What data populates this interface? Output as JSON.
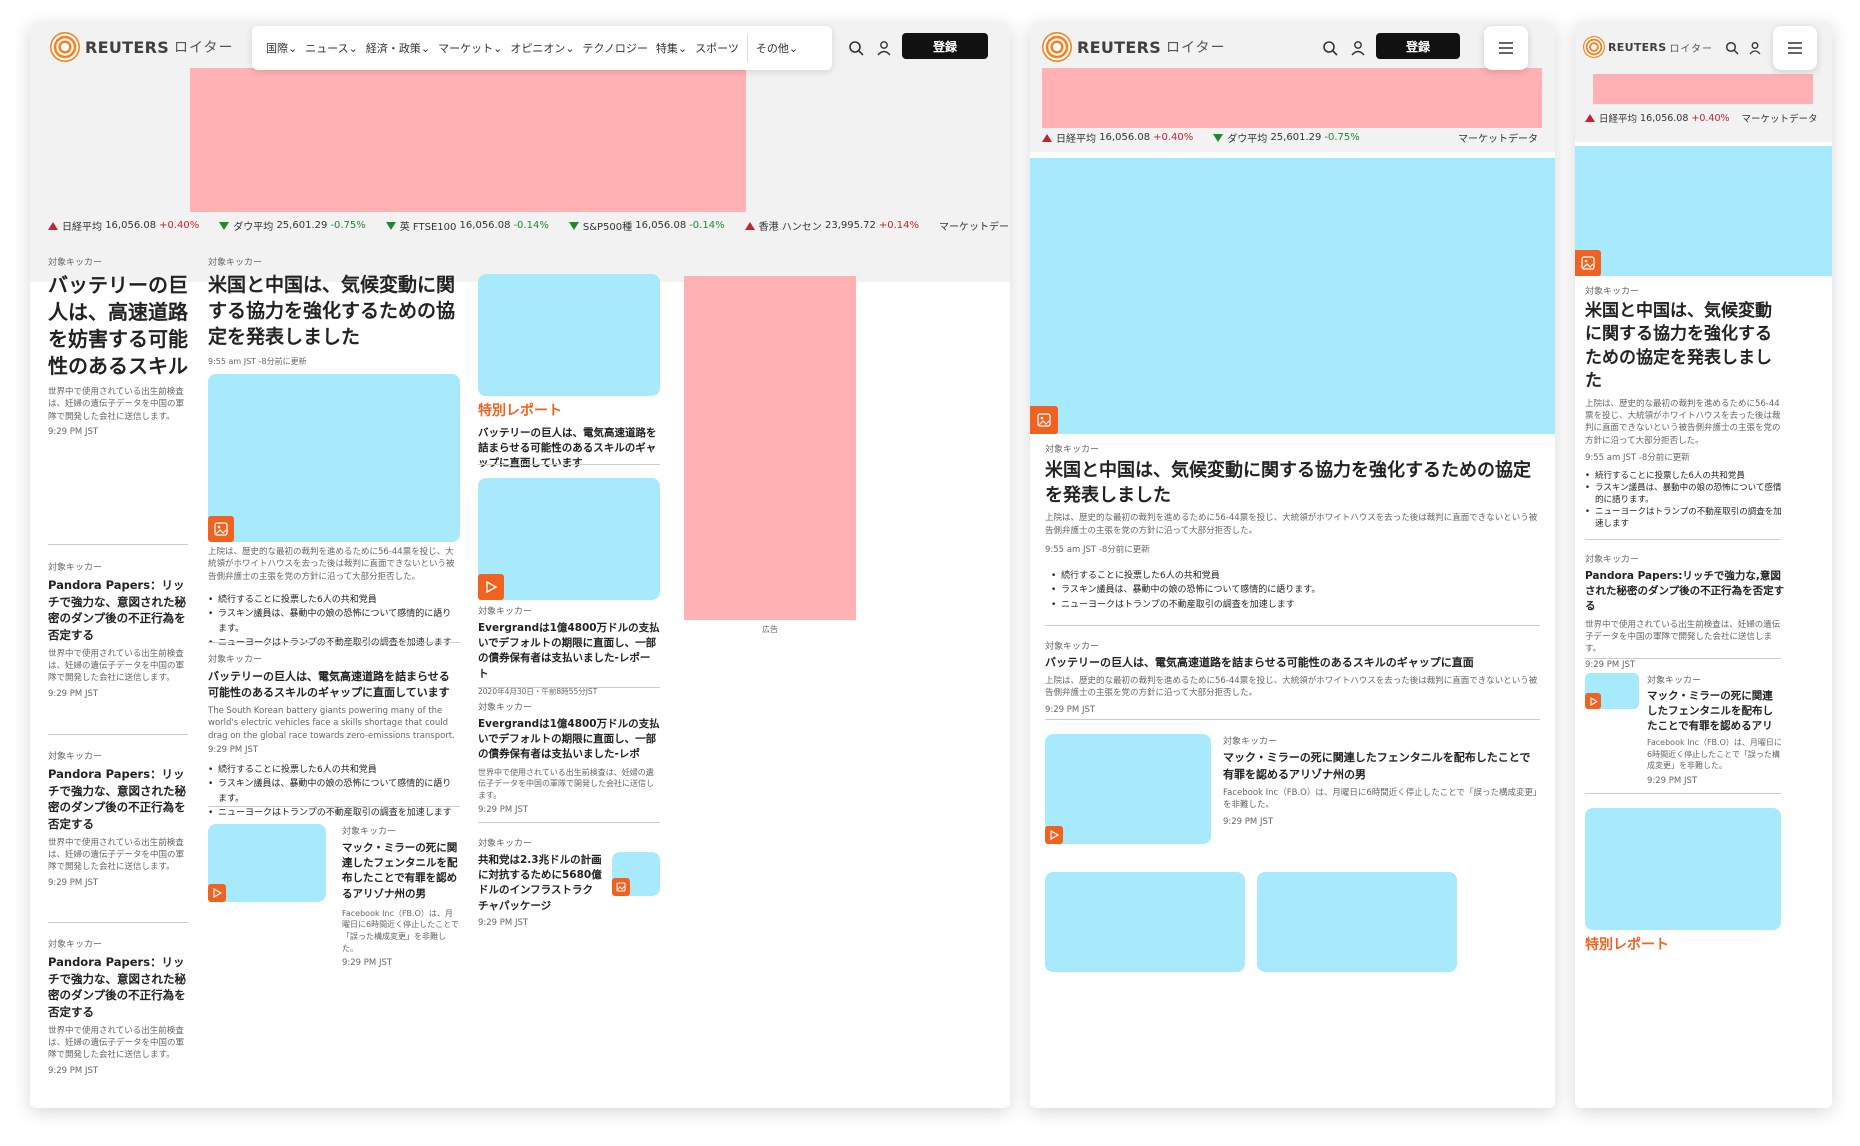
{
  "brand": {
    "name": "REUTERS",
    "jp": "ロイター"
  },
  "nav": {
    "items": [
      "国際",
      "ニュース",
      "経済・政策",
      "マーケット",
      "オピニオン",
      "テクノロジー",
      "特集",
      "スポーツ"
    ],
    "more": "その他"
  },
  "register": "登録",
  "ticker": {
    "nikkei": {
      "label": "日経平均",
      "value": "16,056.08",
      "change": "+0.40%"
    },
    "dow": {
      "label": "ダウ平均",
      "value": "25,601.29",
      "change": "-0.75%"
    },
    "ftse": {
      "label": "英 FTSE100",
      "value": "16,056.08",
      "change": "-0.14%"
    },
    "sp": {
      "label": "S&P500種",
      "value": "16,056.08",
      "change": "-0.14%"
    },
    "hs": {
      "label": "香港 ハンセン",
      "value": "23,995.72",
      "change": "+0.14%"
    },
    "market": "マーケットデータ"
  },
  "kicker": "対象キッカー",
  "ad_label": "広告",
  "special": "特別レポート",
  "desktop": {
    "left": [
      {
        "title": "バッテリーの巨人は、高速道路を妨害する可能性のあるスキル",
        "body": "世界中で使用されている出生前検査は、妊婦の遺伝子データを中国の軍隊で開発した会社に送信します。",
        "time": "9:29 PM JST"
      },
      {
        "title": "Pandora Papers：リッチで強力な、意図された秘密のダンプ後の不正行為を否定する",
        "body": "世界中で使用されている出生前検査は、妊婦の遺伝子データを中国の軍隊で開発した会社に送信します。",
        "time": "9:29 PM JST"
      },
      {
        "title": "Pandora Papers：リッチで強力な、意図された秘密のダンプ後の不正行為を否定する",
        "body": "世界中で使用されている出生前検査は、妊婦の遺伝子データを中国の軍隊で開発した会社に送信します。",
        "time": "9:29 PM JST"
      },
      {
        "title": "Pandora Papers：リッチで強力な、意図された秘密のダンプ後の不正行為を否定する",
        "body": "世界中で使用されている出生前検査は、妊婦の遺伝子データを中国の軍隊で開発した会社に送信します。",
        "time": "9:29 PM JST"
      }
    ],
    "main": {
      "title": "米国と中国は、気候変動に関する協力を強化するための協定を発表しました",
      "time": "9:55 am JST -8分前に更新",
      "body": "上院は、歴史的な最初の裁判を進めるために56-44票を投じ、大統領がホワイトハウスを去った後は裁判に直面できないという被告側弁護士の主張を党の方針に沿って大部分拒否した。",
      "bullets": [
        "続行することに投票した6人の共和党員",
        "ラスキン議員は、暴動中の娘の恐怖について感情的に語ります。",
        "ニューヨークはトランプの不動産取引の調査を加速します"
      ]
    },
    "second": {
      "title": "バッテリーの巨人は、電気高速道路を詰まらせる可能性のあるスキルのギャップに直面しています",
      "body": "The South Korean battery giants powering many of the world's electric vehicles face a skills shortage that could drag on the global race towards zero-emissions transport.",
      "time": "9:29 PM JST",
      "bullets": [
        "続行することに投票した6人の共和党員",
        "ラスキン議員は、暴動中の娘の恐怖について感情的に語ります。",
        "ニューヨークはトランプの不動産取引の調査を加速します"
      ]
    },
    "mac": {
      "title": "マック・ミラーの死に関連したフェンタニルを配布したことで有罪を認めるアリゾナ州の男",
      "body": "Facebook Inc（FB.O）は、月曜日に6時間近く停止したことで「誤った構成変更」を非難した。",
      "time": "9:29 PM JST"
    },
    "special_title": "バッテリーの巨人は、電気高速道路を詰まらせる可能性のあるスキルのギャップに直面しています",
    "ever1": {
      "title": "Evergrandは1億4800万ドルの支払いでデフォルトの期限に直面し、一部の債券保有者は支払いました-レポート",
      "time": "2020年4月30日・午前8時55分JST"
    },
    "ever2": {
      "title": "Evergrandは1億4800万ドルの支払いでデフォルトの期限に直面し、一部の債券保有者は支払いました-レポ",
      "body": "世界中で使用されている出生前検査は、妊婦の遺伝子データを中国の軍隊で開発した会社に送信します。",
      "time": "9:29 PM JST"
    },
    "ccp": {
      "title": "共和党は2.3兆ドルの計画に対抗するために5680億ドルのインフラストラクチャパッケージ",
      "time": "9:29 PM JST"
    }
  },
  "tablet": {
    "main": {
      "title": "米国と中国は、気候変動に関する協力を強化するための協定を発表しました",
      "body": "上院は、歴史的な最初の裁判を進めるために56-44票を投じ、大統領がホワイトハウスを去った後は裁判に直面できないという被告側弁護士の主張を党の方針に沿って大部分拒否した。",
      "time": "9:55 am JST -8分前に更新",
      "bullets": [
        "続行することに投票した6人の共和党員",
        "ラスキン議員は、暴動中の娘の恐怖について感情的に語ります。",
        "ニューヨークはトランプの不動産取引の調査を加速します"
      ]
    },
    "battery": {
      "title": "バッテリーの巨人は、電気高速道路を詰まらせる可能性のあるスキルのギャップに直面",
      "body": "上院は、歴史的な最初の裁判を進めるために56-44票を投じ、大統領がホワイトハウスを去った後は裁判に直面できないという被告側弁護士の主張を党の方針に沿って大部分拒否した。",
      "time": "9:29 PM JST"
    },
    "mac": {
      "title": "マック・ミラーの死に関連したフェンタニルを配布したことで有罪を認めるアリゾナ州の男",
      "body": "Facebook Inc（FB.O）は、月曜日に6時間近く停止したことで「誤った構成変更」を非難した。",
      "time": "9:29 PM JST"
    }
  },
  "mobile": {
    "main": {
      "title": "米国と中国は、気候変動に関する協力を強化するための協定を発表しました",
      "body": "上院は、歴史的な最初の裁判を進めるために56-44票を投じ、大統領がホワイトハウスを去った後は裁判に直面できないという被告側弁護士の主張を党の方針に沿って大部分拒否した。",
      "time": "9:55 am JST -8分前に更新",
      "bullets": [
        "続行することに投票した6人の共和党員",
        "ラスキン議員は、暴動中の娘の恐怖について感情的に語ります。",
        "ニューヨークはトランプの不動産取引の調査を加速します"
      ]
    },
    "pandora": {
      "title": "Pandora Papers:リッチで強力な,意図された秘密のダンプ後の不正行為を否定する",
      "body": "世界中で使用されている出生前検査は、妊婦の遺伝子データを中国の軍隊で開発した会社に送信します。",
      "time": "9:29 PM JST"
    },
    "mac": {
      "title": "マック・ミラーの死に関連したフェンタニルを配布したことで有罪を認めるアリ",
      "body": "Facebook Inc（FB.O）は、月曜日に6時間近く停止したことで「誤った構成変更」を非難した。",
      "time": "9:29 PM JST"
    }
  }
}
